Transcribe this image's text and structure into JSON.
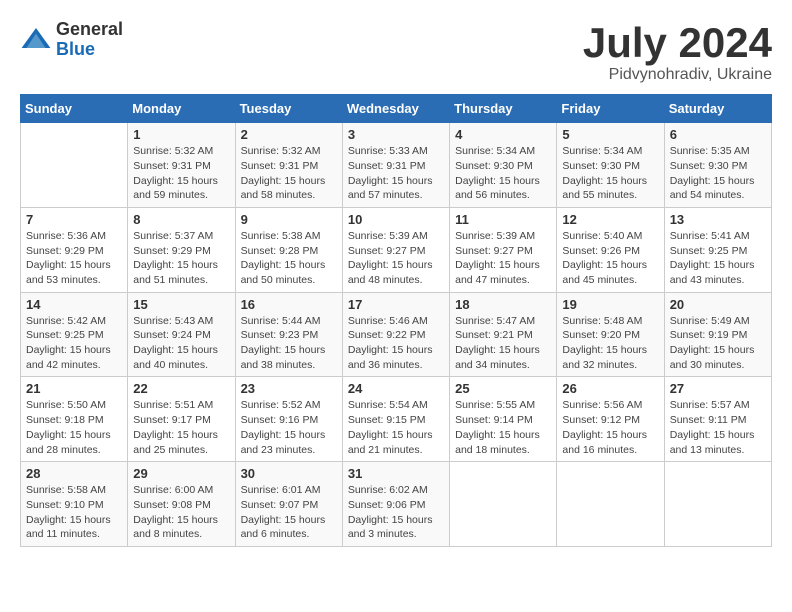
{
  "logo": {
    "general": "General",
    "blue": "Blue"
  },
  "title": "July 2024",
  "location": "Pidvynohradiv, Ukraine",
  "headers": [
    "Sunday",
    "Monday",
    "Tuesday",
    "Wednesday",
    "Thursday",
    "Friday",
    "Saturday"
  ],
  "weeks": [
    [
      {
        "day": "",
        "info": ""
      },
      {
        "day": "1",
        "info": "Sunrise: 5:32 AM\nSunset: 9:31 PM\nDaylight: 15 hours\nand 59 minutes."
      },
      {
        "day": "2",
        "info": "Sunrise: 5:32 AM\nSunset: 9:31 PM\nDaylight: 15 hours\nand 58 minutes."
      },
      {
        "day": "3",
        "info": "Sunrise: 5:33 AM\nSunset: 9:31 PM\nDaylight: 15 hours\nand 57 minutes."
      },
      {
        "day": "4",
        "info": "Sunrise: 5:34 AM\nSunset: 9:30 PM\nDaylight: 15 hours\nand 56 minutes."
      },
      {
        "day": "5",
        "info": "Sunrise: 5:34 AM\nSunset: 9:30 PM\nDaylight: 15 hours\nand 55 minutes."
      },
      {
        "day": "6",
        "info": "Sunrise: 5:35 AM\nSunset: 9:30 PM\nDaylight: 15 hours\nand 54 minutes."
      }
    ],
    [
      {
        "day": "7",
        "info": "Sunrise: 5:36 AM\nSunset: 9:29 PM\nDaylight: 15 hours\nand 53 minutes."
      },
      {
        "day": "8",
        "info": "Sunrise: 5:37 AM\nSunset: 9:29 PM\nDaylight: 15 hours\nand 51 minutes."
      },
      {
        "day": "9",
        "info": "Sunrise: 5:38 AM\nSunset: 9:28 PM\nDaylight: 15 hours\nand 50 minutes."
      },
      {
        "day": "10",
        "info": "Sunrise: 5:39 AM\nSunset: 9:27 PM\nDaylight: 15 hours\nand 48 minutes."
      },
      {
        "day": "11",
        "info": "Sunrise: 5:39 AM\nSunset: 9:27 PM\nDaylight: 15 hours\nand 47 minutes."
      },
      {
        "day": "12",
        "info": "Sunrise: 5:40 AM\nSunset: 9:26 PM\nDaylight: 15 hours\nand 45 minutes."
      },
      {
        "day": "13",
        "info": "Sunrise: 5:41 AM\nSunset: 9:25 PM\nDaylight: 15 hours\nand 43 minutes."
      }
    ],
    [
      {
        "day": "14",
        "info": "Sunrise: 5:42 AM\nSunset: 9:25 PM\nDaylight: 15 hours\nand 42 minutes."
      },
      {
        "day": "15",
        "info": "Sunrise: 5:43 AM\nSunset: 9:24 PM\nDaylight: 15 hours\nand 40 minutes."
      },
      {
        "day": "16",
        "info": "Sunrise: 5:44 AM\nSunset: 9:23 PM\nDaylight: 15 hours\nand 38 minutes."
      },
      {
        "day": "17",
        "info": "Sunrise: 5:46 AM\nSunset: 9:22 PM\nDaylight: 15 hours\nand 36 minutes."
      },
      {
        "day": "18",
        "info": "Sunrise: 5:47 AM\nSunset: 9:21 PM\nDaylight: 15 hours\nand 34 minutes."
      },
      {
        "day": "19",
        "info": "Sunrise: 5:48 AM\nSunset: 9:20 PM\nDaylight: 15 hours\nand 32 minutes."
      },
      {
        "day": "20",
        "info": "Sunrise: 5:49 AM\nSunset: 9:19 PM\nDaylight: 15 hours\nand 30 minutes."
      }
    ],
    [
      {
        "day": "21",
        "info": "Sunrise: 5:50 AM\nSunset: 9:18 PM\nDaylight: 15 hours\nand 28 minutes."
      },
      {
        "day": "22",
        "info": "Sunrise: 5:51 AM\nSunset: 9:17 PM\nDaylight: 15 hours\nand 25 minutes."
      },
      {
        "day": "23",
        "info": "Sunrise: 5:52 AM\nSunset: 9:16 PM\nDaylight: 15 hours\nand 23 minutes."
      },
      {
        "day": "24",
        "info": "Sunrise: 5:54 AM\nSunset: 9:15 PM\nDaylight: 15 hours\nand 21 minutes."
      },
      {
        "day": "25",
        "info": "Sunrise: 5:55 AM\nSunset: 9:14 PM\nDaylight: 15 hours\nand 18 minutes."
      },
      {
        "day": "26",
        "info": "Sunrise: 5:56 AM\nSunset: 9:12 PM\nDaylight: 15 hours\nand 16 minutes."
      },
      {
        "day": "27",
        "info": "Sunrise: 5:57 AM\nSunset: 9:11 PM\nDaylight: 15 hours\nand 13 minutes."
      }
    ],
    [
      {
        "day": "28",
        "info": "Sunrise: 5:58 AM\nSunset: 9:10 PM\nDaylight: 15 hours\nand 11 minutes."
      },
      {
        "day": "29",
        "info": "Sunrise: 6:00 AM\nSunset: 9:08 PM\nDaylight: 15 hours\nand 8 minutes."
      },
      {
        "day": "30",
        "info": "Sunrise: 6:01 AM\nSunset: 9:07 PM\nDaylight: 15 hours\nand 6 minutes."
      },
      {
        "day": "31",
        "info": "Sunrise: 6:02 AM\nSunset: 9:06 PM\nDaylight: 15 hours\nand 3 minutes."
      },
      {
        "day": "",
        "info": ""
      },
      {
        "day": "",
        "info": ""
      },
      {
        "day": "",
        "info": ""
      }
    ]
  ]
}
